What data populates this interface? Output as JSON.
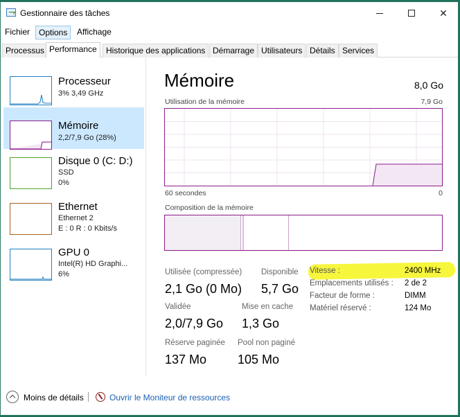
{
  "window": {
    "title": "Gestionnaire des tâches"
  },
  "menu": [
    "Fichier",
    "Options",
    "Affichage"
  ],
  "tabs": [
    "Processus",
    "Performance",
    "Historique des applications",
    "Démarrage",
    "Utilisateurs",
    "Détails",
    "Services"
  ],
  "active_tab": "Performance",
  "sidebar": [
    {
      "title": "Processeur",
      "line1": "3% 3,49 GHz",
      "line2": "",
      "color": "#1f7fc1"
    },
    {
      "title": "Mémoire",
      "line1": "2,2/7,9 Go (28%)",
      "line2": "",
      "color": "#8b1a89"
    },
    {
      "title": "Disque 0 (C: D:)",
      "line1": "SSD",
      "line2": "0%",
      "color": "#4da12a"
    },
    {
      "title": "Ethernet",
      "line1": "Ethernet 2",
      "line2": "E : 0 R : 0 Kbits/s",
      "color": "#a5631b"
    },
    {
      "title": "GPU 0",
      "line1": "Intel(R) HD Graphi...",
      "line2": "6%",
      "color": "#1f7fc1"
    }
  ],
  "main": {
    "title": "Mémoire",
    "total": "8,0 Go",
    "usage_label": "Utilisation de la mémoire",
    "usage_max": "7,9 Go",
    "time_left": "60 secondes",
    "time_right": "0",
    "composition_label": "Composition de la mémoire",
    "usage_level": 0.28,
    "graph_color": "#8b1a89"
  },
  "stats": {
    "used_label": "Utilisée (compressée)",
    "used_value": "2,1 Go (0 Mo)",
    "available_label": "Disponible",
    "available_value": "5,7 Go",
    "committed_label": "Validée",
    "committed_value": "2,0/7,9 Go",
    "cached_label": "Mise en cache",
    "cached_value": "1,3 Go",
    "paged_label": "Réserve paginée",
    "paged_value": "137 Mo",
    "nonpaged_label": "Pool non paginé",
    "nonpaged_value": "105 Mo"
  },
  "details": [
    {
      "key": "Vitesse :",
      "value": "2400 MHz"
    },
    {
      "key": "Emplacements utilisés :",
      "value": "2 de 2"
    },
    {
      "key": "Facteur de forme :",
      "value": "DIMM"
    },
    {
      "key": "Matériel réservé :",
      "value": "124 Mo"
    }
  ],
  "footer": {
    "less_details": "Moins de détails",
    "resource_monitor": "Ouvrir le Moniteur de ressources"
  }
}
